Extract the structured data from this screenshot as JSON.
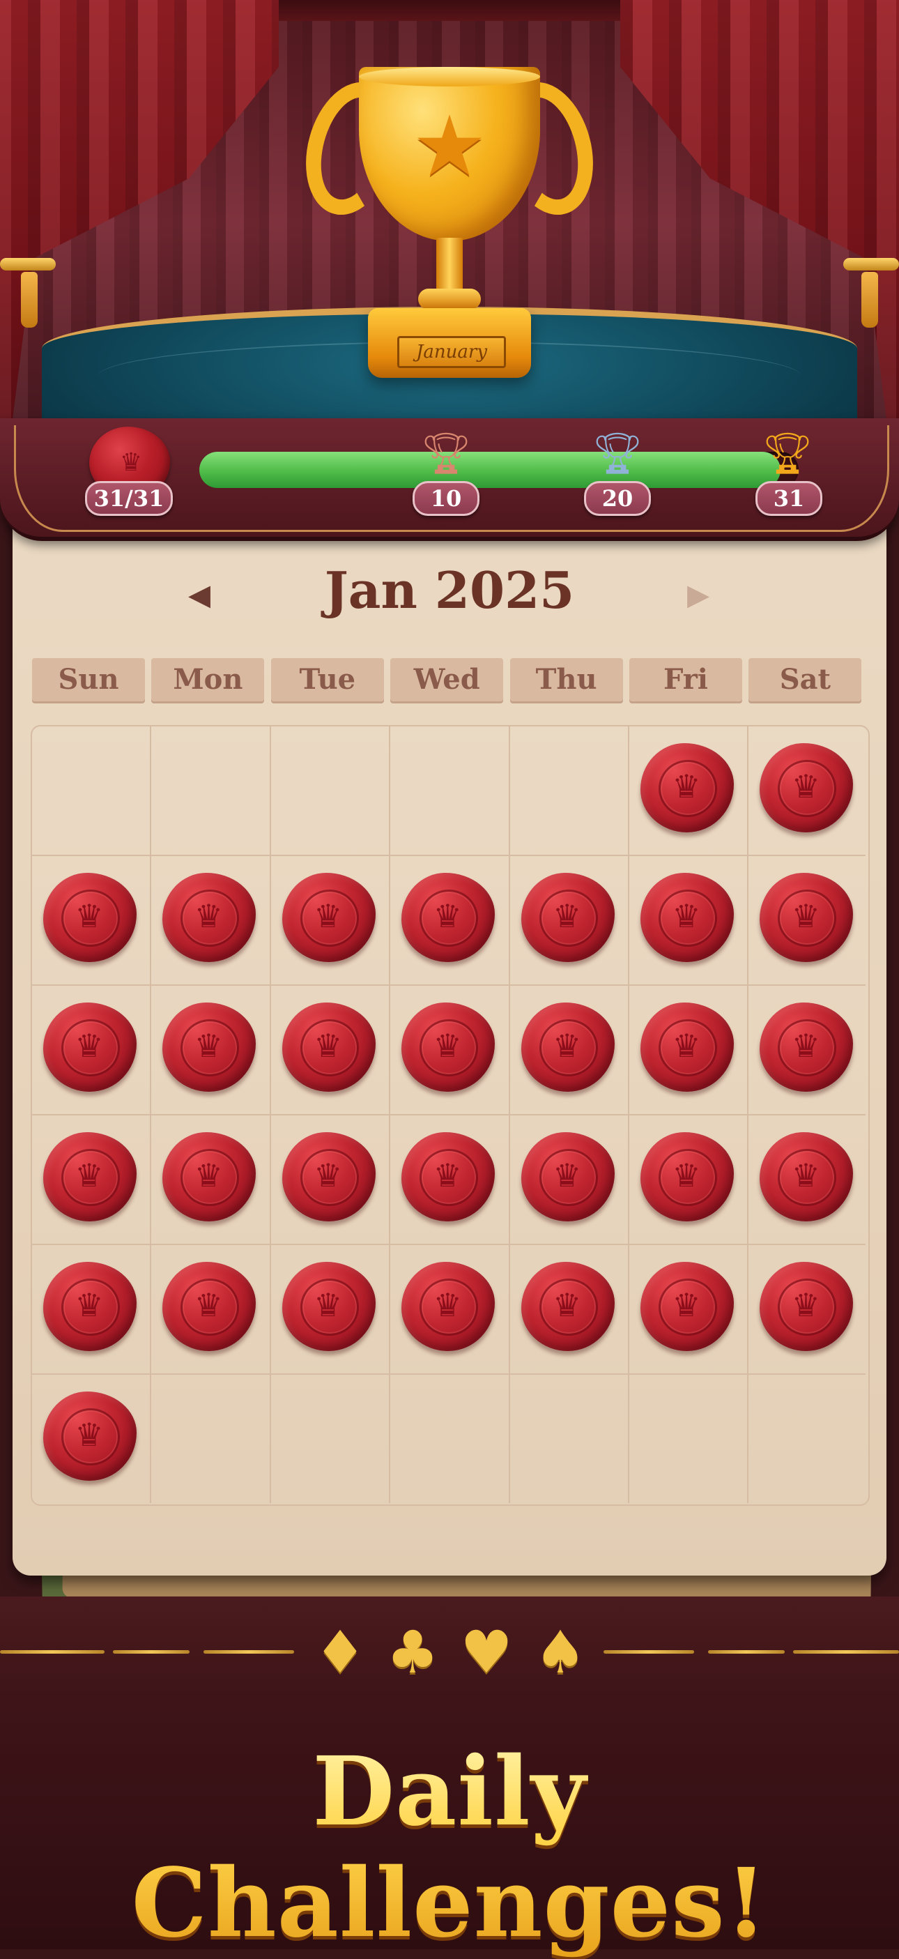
{
  "trophy": {
    "plaque_text": "January",
    "icon": "trophy-icon",
    "color": "#f3b01f"
  },
  "progress": {
    "stamp_count": "31/31",
    "completed_days": 31,
    "total_days": 31,
    "fill_fraction": 0.97,
    "bar_color": "#4fbb48",
    "milestones": [
      {
        "label": "10",
        "icon": "bronze-trophy-icon",
        "color": "#d8866e"
      },
      {
        "label": "20",
        "icon": "silver-trophy-icon",
        "color": "#8fb2d6"
      },
      {
        "label": "31",
        "icon": "gold-trophy-icon",
        "color": "#f2a81a"
      }
    ]
  },
  "calendar": {
    "month_title": "Jan 2025",
    "prev_icon": "arrow-left-icon",
    "next_icon": "arrow-right-icon",
    "weekdays": [
      "Sun",
      "Mon",
      "Tue",
      "Wed",
      "Thu",
      "Fri",
      "Sat"
    ],
    "first_weekday_index": 5,
    "days_in_month": 31,
    "stamped_days": 31,
    "stamp_icon": "wax-seal-crown-icon",
    "stamp_color": "#c22630"
  },
  "suits": [
    "♦",
    "♣",
    "♥",
    "♠"
  ],
  "banner": {
    "title": "Daily Challenges!"
  }
}
